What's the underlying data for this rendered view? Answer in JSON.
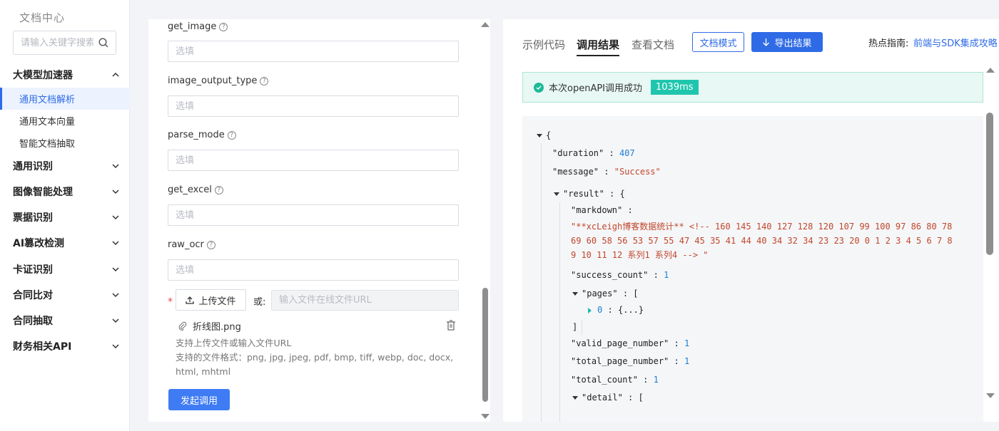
{
  "sidebar": {
    "title": "文档中心",
    "search_placeholder": "请输入关键字搜索",
    "categories": [
      {
        "label": "大模型加速器"
      },
      {
        "label": "通用识别"
      },
      {
        "label": "图像智能处理"
      },
      {
        "label": "票据识别"
      },
      {
        "label": "AI篡改检测"
      },
      {
        "label": "卡证识别"
      },
      {
        "label": "合同比对"
      },
      {
        "label": "合同抽取"
      },
      {
        "label": "财务相关API"
      }
    ],
    "sub_items": [
      {
        "label": "通用文档解析",
        "active": true
      },
      {
        "label": "通用文本向量"
      },
      {
        "label": "智能文档抽取"
      }
    ]
  },
  "form": {
    "fields": [
      {
        "label": "get_image",
        "placeholder": "选填"
      },
      {
        "label": "image_output_type",
        "placeholder": "选填"
      },
      {
        "label": "parse_mode",
        "placeholder": "选填"
      },
      {
        "label": "get_excel",
        "placeholder": "选填"
      },
      {
        "label": "raw_ocr",
        "placeholder": "选填"
      }
    ],
    "required_mark": "*",
    "upload_label": "上传文件",
    "or_label": "或:",
    "url_placeholder": "输入文件在线文件URL",
    "file_name": "折线图.png",
    "hint_1": "支持上传文件或输入文件URL",
    "hint_2": "支持的文件格式：png, jpg, jpeg, pdf, bmp, tiff, webp, doc, docx, html, mhtml",
    "submit_label": "发起调用"
  },
  "result": {
    "tabs": [
      {
        "label": "示例代码"
      },
      {
        "label": "调用结果",
        "active": true
      },
      {
        "label": "查看文档"
      }
    ],
    "doc_mode_label": "文档模式",
    "export_label": "导出结果",
    "hot_label": "热点指南:",
    "hot_link": "前端与SDK集成攻略",
    "success_text": "本次openAPI调用成功",
    "duration_badge": "1039ms",
    "json": {
      "open_brace": "{",
      "duration_key": "\"duration\"",
      "duration_val": "407",
      "message_key": "\"message\"",
      "message_val": "\"Success\"",
      "result_key": "\"result\"",
      "markdown_key": "\"markdown\"",
      "markdown_val": "\"**xcLeigh博客数据统计** <!-- 160 145 140 127 128 120 107 99 100 97 86 80 78 69 60 58 56 53 57 55 47 45 35 41 44 40 34 32 34 23 23 20 0 1 2 3 4 5 6 7 8 9 10 11 12 系列1 系列4 --> \"",
      "success_count_key": "\"success_count\"",
      "success_count_val": "1",
      "pages_key": "\"pages\"",
      "pages_item_key": "0",
      "pages_item_val": "{...}",
      "close_bracket": "]",
      "valid_page_key": "\"valid_page_number\"",
      "valid_page_val": "1",
      "total_page_key": "\"total_page_number\"",
      "total_page_val": "1",
      "total_count_key": "\"total_count\"",
      "total_count_val": "1",
      "detail_key": "\"detail\"",
      "colon": ":",
      "obj_open": "{",
      "arr_open": "["
    }
  },
  "colors": {
    "accent": "#2f6be6",
    "success": "#1db999",
    "badge": "#1fc6ad",
    "json_string": "#c0472b",
    "json_number": "#1a7fd4"
  }
}
